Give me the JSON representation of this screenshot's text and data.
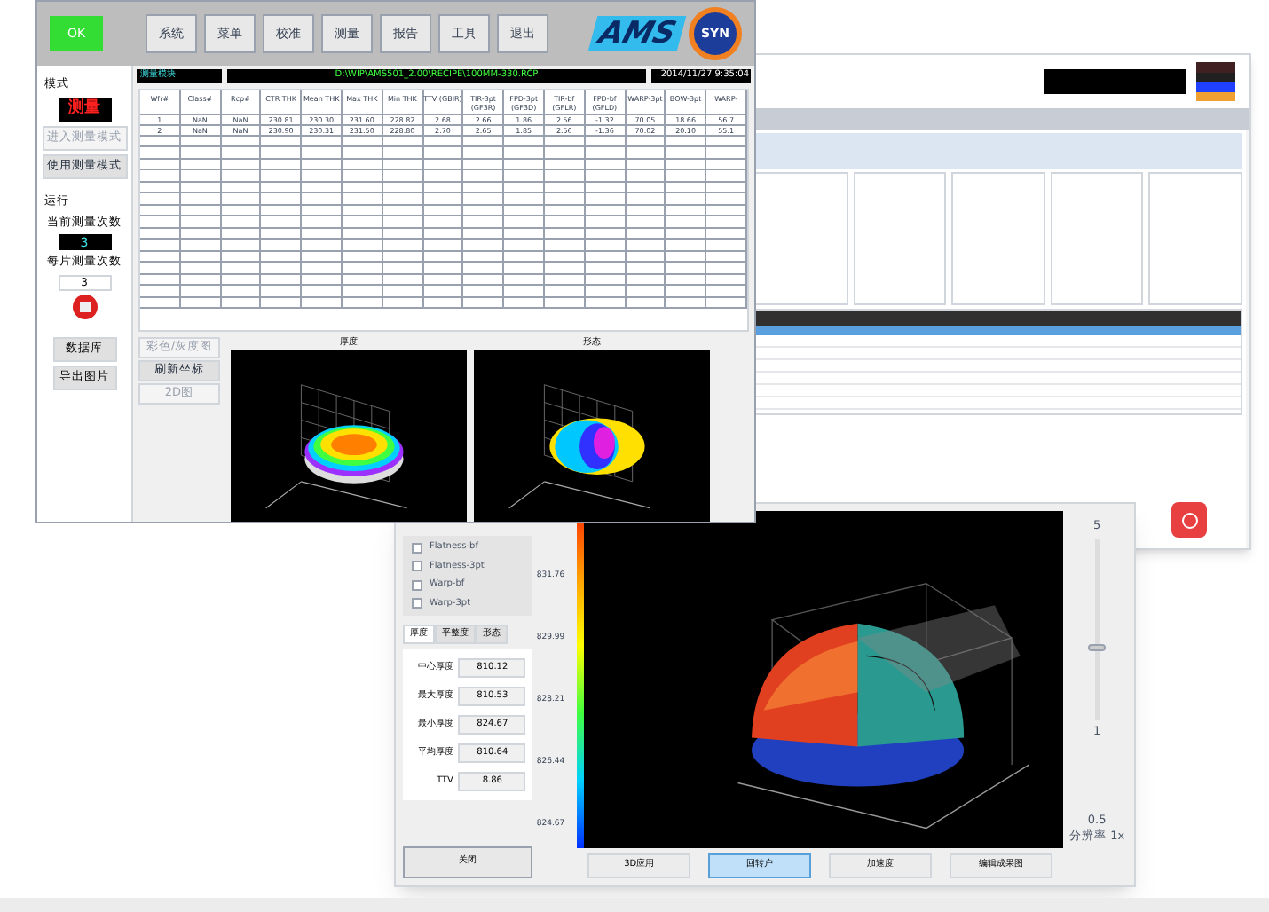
{
  "main_window": {
    "status_button": "OK",
    "menu": [
      "系统",
      "菜单",
      "校准",
      "测量",
      "报告",
      "工具",
      "退出"
    ],
    "logo": {
      "text": "AMS",
      "badge": "SYN"
    },
    "module_label": "测量模块",
    "recipe_path": "D:\\WIP\\AMS501_2.00\\RECIPE\\100MM-330.RCP",
    "timestamp": "2014/11/27 9:35:04",
    "sidebar": {
      "mode_title": "模式",
      "mode_display": "测量",
      "mode_buttons": [
        {
          "label": "进入测量模式",
          "disabled": true
        },
        {
          "label": "使用测量模式",
          "disabled": false
        }
      ],
      "run_title": "运行",
      "current_count_label": "当前测量次数",
      "current_count": "3",
      "per_wafer_label": "每片测量次数",
      "per_wafer": "3",
      "tool_buttons": [
        "数据库",
        "导出图片"
      ]
    },
    "table": {
      "columns": [
        "Wfr#",
        "Class#",
        "Rcp#",
        "CTR THK",
        "Mean THK",
        "Max THK",
        "Min THK",
        "TTV (GBIR)",
        "TIR-3pt (GF3R)",
        "FPD-3pt (GF3D)",
        "TIR-bf (GFLR)",
        "FPD-bf (GFLD)",
        "WARP-3pt",
        "BOW-3pt",
        "WARP-"
      ],
      "rows": [
        [
          "1",
          "NaN",
          "NaN",
          "230.81",
          "230.30",
          "231.60",
          "228.82",
          "2.68",
          "2.66",
          "1.86",
          "2.56",
          "-1.32",
          "70.05",
          "18.66",
          "56.7"
        ],
        [
          "2",
          "NaN",
          "NaN",
          "230.90",
          "230.31",
          "231.50",
          "228.80",
          "2.70",
          "2.65",
          "1.85",
          "2.56",
          "-1.36",
          "70.02",
          "20.10",
          "55.1"
        ]
      ]
    },
    "view_buttons": [
      {
        "label": "彩色/灰度图",
        "disabled": true
      },
      {
        "label": "刷新坐标",
        "disabled": false
      },
      {
        "label": "2D图",
        "disabled": true
      }
    ],
    "charts": [
      {
        "title": "厚度",
        "kind": "thickness"
      },
      {
        "title": "形态",
        "kind": "shape"
      }
    ]
  },
  "analysis_window": {
    "checkboxes": [
      {
        "label": "Flatness-bf",
        "checked": false
      },
      {
        "label": "Flatness-3pt",
        "checked": false
      },
      {
        "label": "Warp-bf",
        "checked": false
      },
      {
        "label": "Warp-3pt",
        "checked": false
      }
    ],
    "tabs": [
      {
        "label": "厚度",
        "selected": true
      },
      {
        "label": "平整度",
        "selected": false
      },
      {
        "label": "形态",
        "selected": false
      }
    ],
    "fields": [
      {
        "label": "中心厚度",
        "value": "810.12"
      },
      {
        "label": "最大厚度",
        "value": "810.53"
      },
      {
        "label": "最小厚度",
        "value": "824.67"
      },
      {
        "label": "平均厚度",
        "value": "810.64"
      },
      {
        "label": "TTV",
        "value": "8.86"
      }
    ],
    "close_button": "关闭",
    "scale_labels": [
      "831.76",
      "829.99",
      "828.21",
      "826.44",
      "824.67"
    ],
    "buttons": [
      {
        "label": "3D应用",
        "selected": false
      },
      {
        "label": "回转户",
        "selected": true
      },
      {
        "label": "加速度",
        "selected": false
      },
      {
        "label": "编辑成果图",
        "selected": false
      }
    ],
    "zoom_labels": [
      "5",
      "1",
      "0.5"
    ],
    "resolution_label": "分辨率 1x",
    "zoom_slider": {
      "level": 0.4
    }
  }
}
